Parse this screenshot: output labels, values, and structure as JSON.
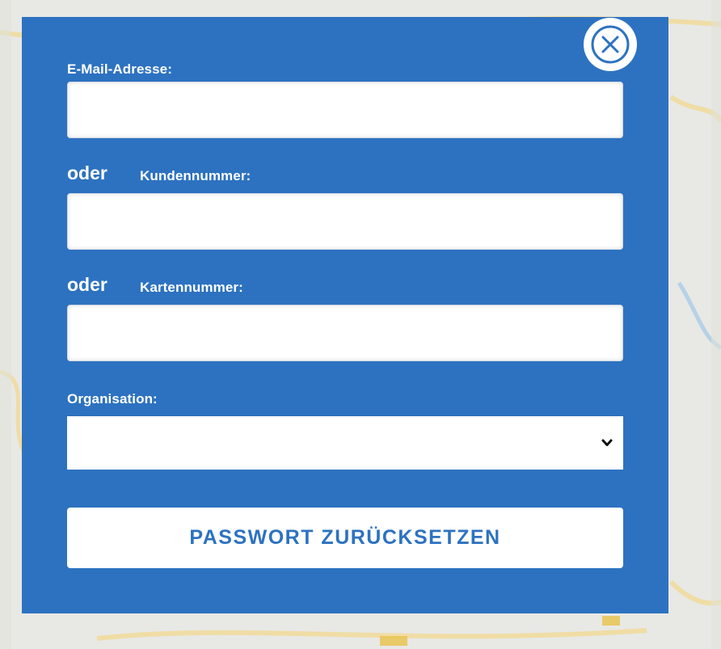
{
  "form": {
    "email_label": "E-Mail-Adresse:",
    "email_value": "",
    "or_1": "oder",
    "customer_label": "Kundennummer:",
    "customer_value": "",
    "or_2": "oder",
    "card_label": "Kartennummer:",
    "card_value": "",
    "organisation_label": "Organisation:",
    "organisation_value": "",
    "submit_label": "PASSWORT ZURÜCKSETZEN"
  },
  "icons": {
    "close": "close-icon",
    "select_arrow": "chevron-down-icon"
  },
  "colors": {
    "modal_background": "#2d72c0",
    "button_text": "#2d72c0",
    "field_background": "#ffffff"
  }
}
